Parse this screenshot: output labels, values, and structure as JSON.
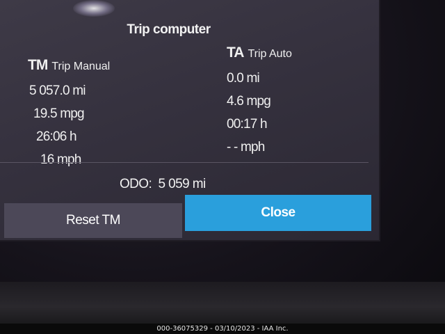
{
  "screen": {
    "title": "Trip computer"
  },
  "trip_manual": {
    "abbr": "TM",
    "label": "Trip Manual",
    "distance": "5 057.0 mi",
    "fuel_economy": "19.5 mpg",
    "time": "26:06 h",
    "speed": "16 mph"
  },
  "trip_auto": {
    "abbr": "TA",
    "label": "Trip Auto",
    "distance": "0.0 mi",
    "fuel_economy": "4.6 mpg",
    "time": "00:17 h",
    "speed": "- - mph"
  },
  "odometer": {
    "text": "ODO:  5 059 mi"
  },
  "buttons": {
    "reset_label": "Reset TM",
    "close_label": "Close"
  },
  "footer": {
    "watermark": "000-36075329 - 03/10/2023 - IAA Inc."
  },
  "colors": {
    "close_button": "#2a9fdc",
    "reset_button": "#4c4858",
    "screen_bg": "#3a3642"
  }
}
